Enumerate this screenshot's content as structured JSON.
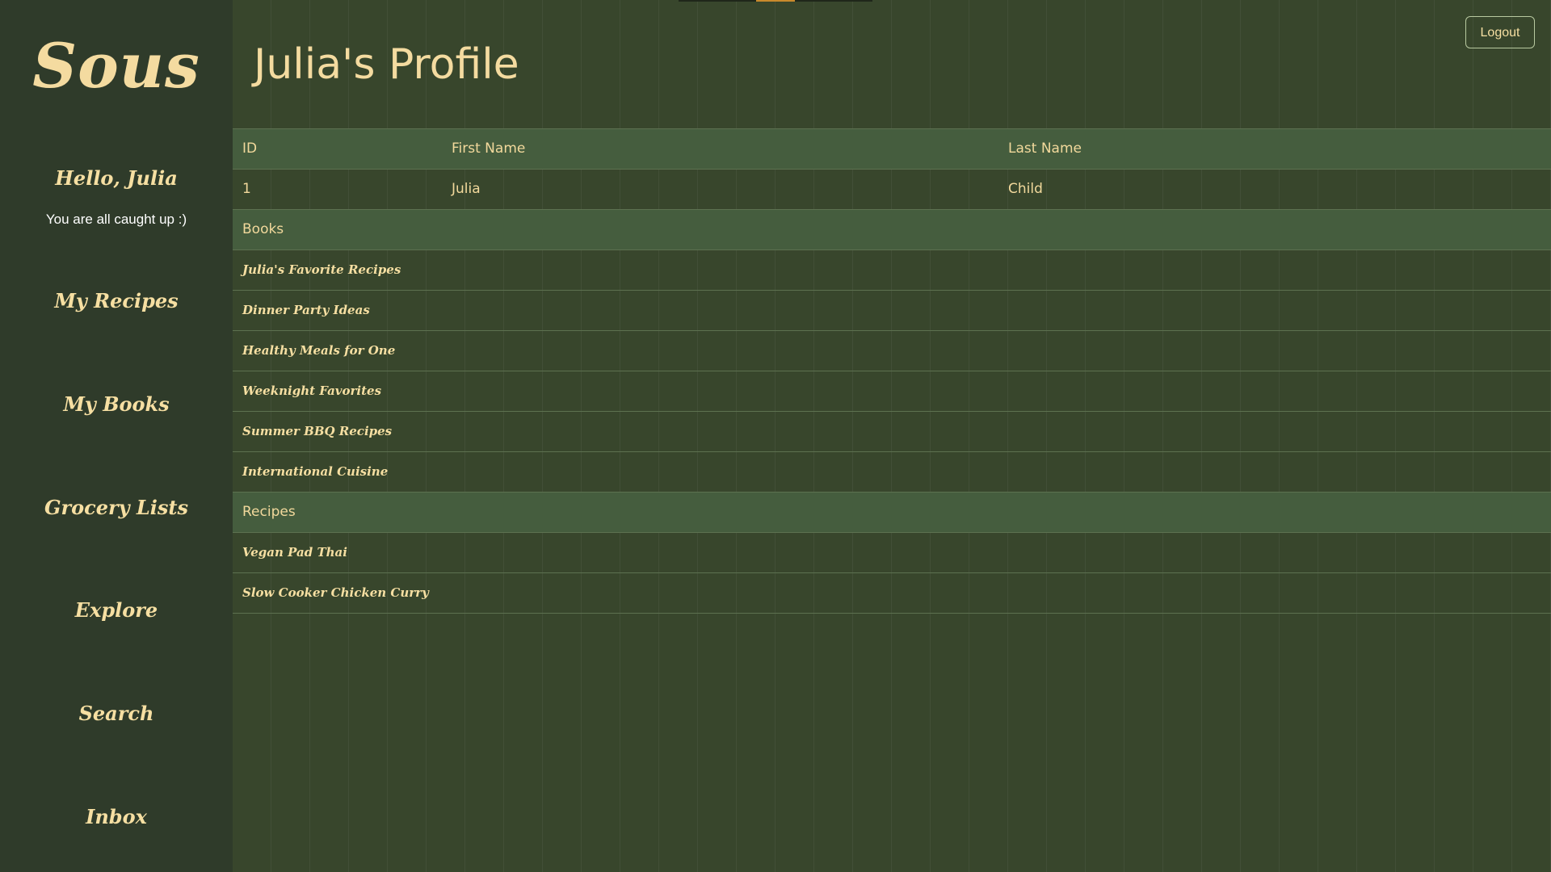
{
  "sidebar": {
    "brand": "Sous",
    "greeting": "Hello, Julia",
    "status": "You are all caught up :)",
    "nav": [
      {
        "label": "My Recipes"
      },
      {
        "label": "My Books"
      },
      {
        "label": "Grocery Lists"
      },
      {
        "label": "Explore"
      },
      {
        "label": "Search"
      },
      {
        "label": "Inbox"
      }
    ]
  },
  "header": {
    "title": "Julia's Profile",
    "logout_label": "Logout"
  },
  "profile_table": {
    "columns": [
      "ID",
      "First Name",
      "Last Name"
    ],
    "row": {
      "id": "1",
      "first_name": "Julia",
      "last_name": "Child"
    }
  },
  "books": {
    "heading": "Books",
    "items": [
      "Julia's Favorite Recipes",
      "Dinner Party Ideas",
      "Healthy Meals for One",
      "Weeknight Favorites",
      "Summer BBQ Recipes",
      "International Cuisine"
    ]
  },
  "recipes": {
    "heading": "Recipes",
    "items": [
      "Vegan Pad Thai",
      "Slow Cooker Chicken Curry"
    ]
  },
  "colors": {
    "sidebar_bg": "#2f3b2a",
    "main_bg": "#38462c",
    "header_row_bg": "#455d3e",
    "accent_text": "#f6dfa2",
    "indicator_active": "#c98a2c"
  }
}
